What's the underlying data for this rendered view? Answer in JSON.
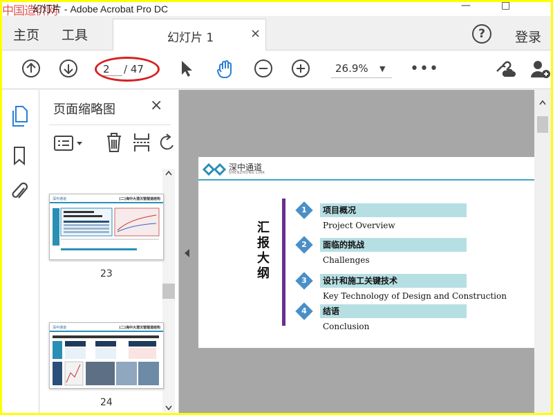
{
  "window": {
    "watermark": "中国造价网",
    "title": "幻灯片 - Adobe Acrobat Pro DC",
    "min_glyph": "—",
    "max_glyph": "□"
  },
  "tabs": {
    "home": "主页",
    "tools": "工具",
    "doc_tab": "幻灯片 1",
    "close_glyph": "×",
    "help_glyph": "?",
    "login": "登录"
  },
  "toolbar": {
    "current_page": "2",
    "total_pages": "/ 47",
    "zoom": "26.9%",
    "zoom_arrow": "▼",
    "more": "•••"
  },
  "thumbnails": {
    "title": "页面缩略图",
    "close_glyph": "×",
    "items": [
      {
        "page": "23",
        "logo": "深中通道",
        "header": "(二)海中大潜沉管隧道结构"
      },
      {
        "page": "24",
        "logo": "深中通道",
        "header": "(二)海中大潜沉管隧道结构"
      }
    ]
  },
  "slide": {
    "brand_cn": "深中通道",
    "brand_en": "SHENZHONG LINK",
    "vertical_title": "汇报大纲",
    "items": [
      {
        "num": "1",
        "cn": "项目概况",
        "en": "Project Overview"
      },
      {
        "num": "2",
        "cn": "面临的挑战",
        "en": "Challenges"
      },
      {
        "num": "3",
        "cn": "设计和施工关键技术",
        "en": "Key Technology of Design and Construction"
      },
      {
        "num": "4",
        "cn": "结语",
        "en": "Conclusion"
      }
    ]
  },
  "colors": {
    "accent_red": "#d82020",
    "slide_band": "#b6dfe4",
    "slide_vline": "#6a2f8e",
    "diamond": "#4a8fc7",
    "icon_blue": "#2a7fd4"
  }
}
